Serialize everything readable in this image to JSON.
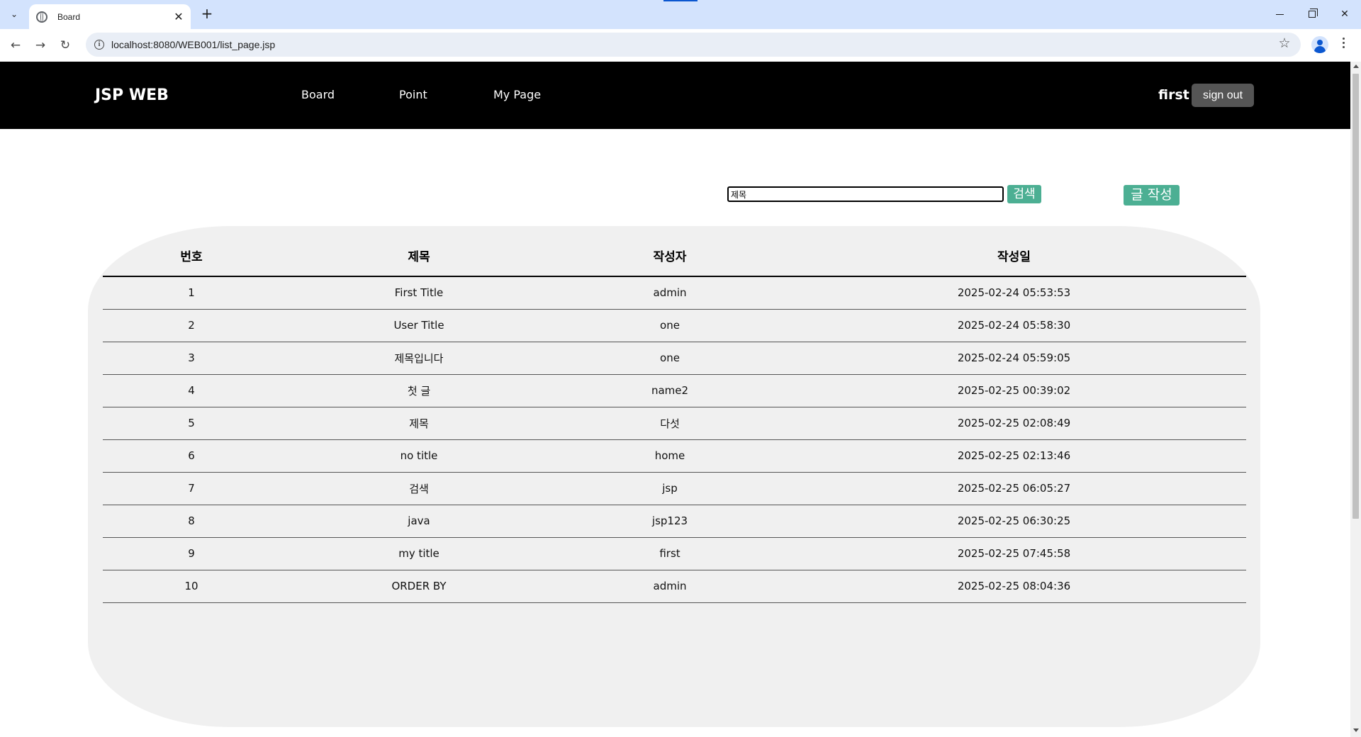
{
  "browser": {
    "tab_title": "Board",
    "tab_close": "✕",
    "new_tab": "+",
    "url": "localhost:8080/WEB001/list_page.jsp"
  },
  "header": {
    "logo": "JSP WEB",
    "menu": [
      {
        "label": "Board"
      },
      {
        "label": "Point"
      },
      {
        "label": "My Page"
      }
    ],
    "username": "first",
    "signout_label": "sign out"
  },
  "search": {
    "value": "제목",
    "button_label": "검색",
    "write_label": "글 작성"
  },
  "table": {
    "headers": [
      "번호",
      "제목",
      "작성자",
      "작성일"
    ],
    "rows": [
      {
        "num": "1",
        "title": "First Title",
        "author": "admin",
        "date": "2025-02-24 05:53:53"
      },
      {
        "num": "2",
        "title": "User Title",
        "author": "one",
        "date": "2025-02-24 05:58:30"
      },
      {
        "num": "3",
        "title": "제목입니다",
        "author": "one",
        "date": "2025-02-24 05:59:05"
      },
      {
        "num": "4",
        "title": "첫 글",
        "author": "name2",
        "date": "2025-02-25 00:39:02"
      },
      {
        "num": "5",
        "title": "제목",
        "author": "다섯",
        "date": "2025-02-25 02:08:49"
      },
      {
        "num": "6",
        "title": "no title",
        "author": "home",
        "date": "2025-02-25 02:13:46"
      },
      {
        "num": "7",
        "title": "검색",
        "author": "jsp",
        "date": "2025-02-25 06:05:27"
      },
      {
        "num": "8",
        "title": "java",
        "author": "jsp123",
        "date": "2025-02-25 06:30:25"
      },
      {
        "num": "9",
        "title": "my title",
        "author": "first",
        "date": "2025-02-25 07:45:58"
      },
      {
        "num": "10",
        "title": "ORDER BY",
        "author": "admin",
        "date": "2025-02-25 08:04:36"
      }
    ]
  },
  "colors": {
    "header_bg": "#000000",
    "accent_button": "#4caf93",
    "signout_bg": "#555555",
    "panel_bg": "#f0f0f0",
    "browser_tabbar": "#d3e3fd"
  },
  "icons": [
    "tab-list-icon",
    "globe-icon",
    "close-icon",
    "plus-icon",
    "back-arrow-icon",
    "forward-arrow-icon",
    "reload-icon",
    "info-icon",
    "star-icon",
    "profile-icon",
    "more-vert-icon",
    "minimize-icon",
    "restore-icon",
    "window-close-icon"
  ]
}
